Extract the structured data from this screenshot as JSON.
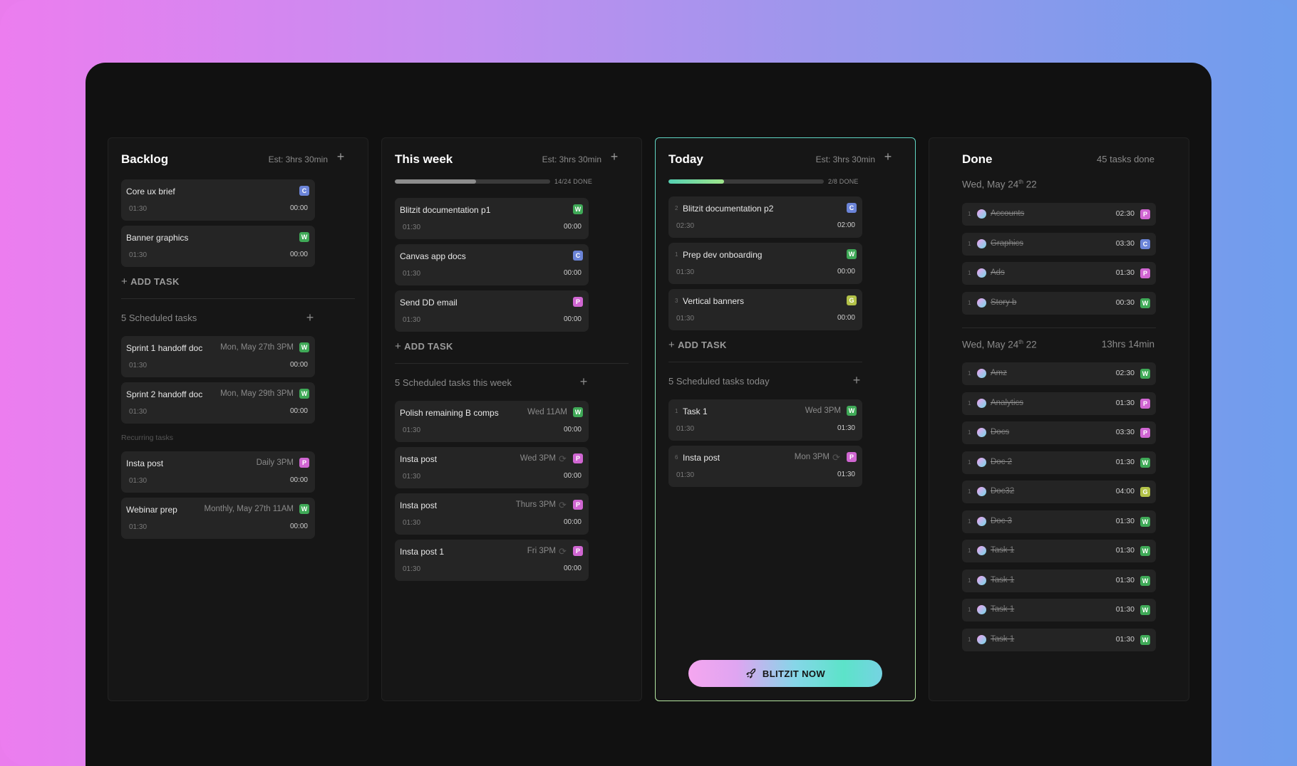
{
  "colors": {
    "W": "#3fa957",
    "C": "#6b84d8",
    "P": "#d066d2",
    "G": "#b3c248"
  },
  "backlog": {
    "title": "Backlog",
    "est": "Est: 3hrs 30min",
    "cards": [
      {
        "title": "Core ux brief",
        "badge": "C",
        "est": "01:30",
        "time": "00:00"
      },
      {
        "title": "Banner graphics",
        "badge": "W",
        "est": "01:30",
        "time": "00:00"
      }
    ],
    "add_task": "ADD TASK",
    "scheduled_title": "5 Scheduled tasks",
    "scheduled": [
      {
        "title": "Sprint 1 handoff doc",
        "date": "Mon, May 27th 3PM",
        "badge": "W",
        "est": "01:30",
        "time": "00:00"
      },
      {
        "title": "Sprint 2 handoff doc",
        "date": "Mon, May 29th 3PM",
        "badge": "W",
        "est": "01:30",
        "time": "00:00"
      }
    ],
    "recurring_title": "Recurring tasks",
    "recurring": [
      {
        "title": "Insta post",
        "date": "Daily 3PM",
        "badge": "P",
        "est": "01:30",
        "time": "00:00"
      },
      {
        "title": "Webinar prep",
        "date": "Monthly, May 27th 11AM",
        "badge": "W",
        "est": "01:30",
        "time": "00:00"
      }
    ]
  },
  "week": {
    "title": "This week",
    "est": "Est: 3hrs 30min",
    "progress_label": "14/24 DONE",
    "progress": 0.525,
    "cards": [
      {
        "title": "Blitzit documentation p1",
        "badge": "W",
        "est": "01:30",
        "time": "00:00"
      },
      {
        "title": "Canvas app docs",
        "badge": "C",
        "est": "01:30",
        "time": "00:00"
      },
      {
        "title": "Send DD email",
        "badge": "P",
        "est": "01:30",
        "time": "00:00"
      }
    ],
    "add_task": "ADD TASK",
    "scheduled_title": "5 Scheduled tasks this week",
    "scheduled": [
      {
        "title": "Polish remaining B comps",
        "date": "Wed 11AM",
        "badge": "W",
        "est": "01:30",
        "time": "00:00",
        "recur": false
      },
      {
        "title": "Insta post",
        "date": "Wed 3PM",
        "badge": "P",
        "est": "01:30",
        "time": "00:00",
        "recur": true
      },
      {
        "title": "Insta post",
        "date": "Thurs 3PM",
        "badge": "P",
        "est": "01:30",
        "time": "00:00",
        "recur": true
      },
      {
        "title": "Insta post 1",
        "date": "Fri 3PM",
        "badge": "P",
        "est": "01:30",
        "time": "00:00",
        "recur": true
      }
    ]
  },
  "today": {
    "title": "Today",
    "est": "Est: 3hrs 30min",
    "progress_label": "2/8 DONE",
    "progress": 0.36,
    "cards": [
      {
        "num": "2",
        "title": "Blitzit documentation p2",
        "badge": "C",
        "est": "02:30",
        "time": "02:00"
      },
      {
        "num": "1",
        "title": "Prep dev onboarding",
        "badge": "W",
        "est": "01:30",
        "time": "00:00"
      },
      {
        "num": "3",
        "title": "Vertical banners",
        "badge": "G",
        "est": "01:30",
        "time": "00:00"
      }
    ],
    "add_task": "ADD TASK",
    "scheduled_title": "5 Scheduled tasks today",
    "scheduled": [
      {
        "num": "1",
        "title": "Task 1",
        "date": "Wed 3PM",
        "badge": "W",
        "est": "01:30",
        "time": "01:30",
        "recur": false
      },
      {
        "num": "6",
        "title": "Insta post",
        "date": "Mon 3PM",
        "badge": "P",
        "est": "01:30",
        "time": "01:30",
        "recur": true
      }
    ],
    "cta": "BLITZIT NOW"
  },
  "done": {
    "title": "Done",
    "count": "45 tasks done",
    "group1": {
      "date": "Wed, May 24",
      "date_sup": "th",
      "date_tail": " 22",
      "rows": [
        {
          "num": "1",
          "title": "Accounts",
          "time": "02:30",
          "badge": "P"
        },
        {
          "num": "1",
          "title": "Graphics",
          "time": "03:30",
          "badge": "C"
        },
        {
          "num": "1",
          "title": "Ads",
          "time": "01:30",
          "badge": "P"
        },
        {
          "num": "1",
          "title": "Story b",
          "time": "00:30",
          "badge": "W"
        }
      ]
    },
    "group2": {
      "date": "Wed, May 24",
      "date_sup": "th",
      "date_tail": " 22",
      "total": "13hrs 14min",
      "rows": [
        {
          "num": "1",
          "title": "Amz",
          "time": "02:30",
          "badge": "W"
        },
        {
          "num": "1",
          "title": "Analytics",
          "time": "01:30",
          "badge": "P"
        },
        {
          "num": "1",
          "title": "Docs",
          "time": "03:30",
          "badge": "P"
        },
        {
          "num": "1",
          "title": "Doc 2",
          "time": "01:30",
          "badge": "W"
        },
        {
          "num": "1",
          "title": "Doc32",
          "time": "04:00",
          "badge": "G"
        },
        {
          "num": "1",
          "title": "Doc 3",
          "time": "01:30",
          "badge": "W"
        },
        {
          "num": "1",
          "title": "Task 1",
          "time": "01:30",
          "badge": "W"
        },
        {
          "num": "1",
          "title": "Task 1",
          "time": "01:30",
          "badge": "W"
        },
        {
          "num": "1",
          "title": "Task 1",
          "time": "01:30",
          "badge": "W"
        },
        {
          "num": "1",
          "title": "Task 1",
          "time": "01:30",
          "badge": "W"
        }
      ]
    }
  }
}
